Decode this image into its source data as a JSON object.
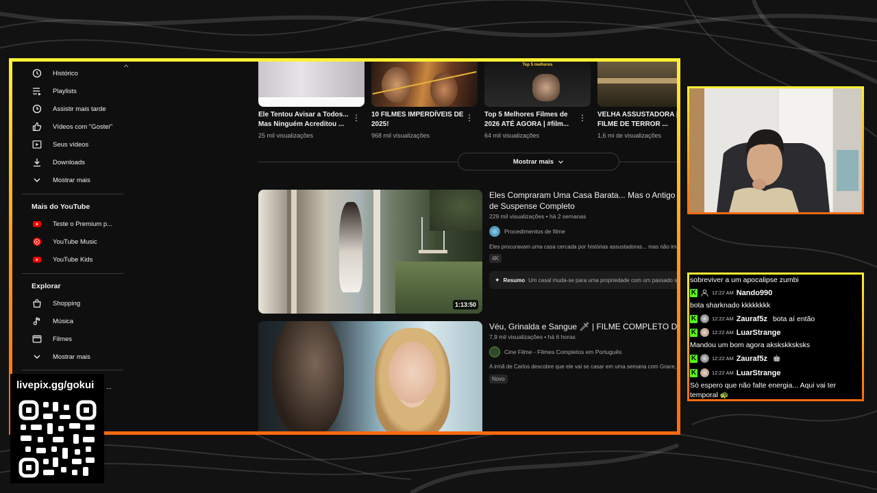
{
  "sidebar": {
    "items_top": [
      {
        "icon": "history-icon",
        "label": "Histórico"
      },
      {
        "icon": "playlists-icon",
        "label": "Playlists"
      },
      {
        "icon": "watch-later-icon",
        "label": "Assistir mais tarde"
      },
      {
        "icon": "liked-videos-icon",
        "label": "Vídeos com \"Gostei\""
      },
      {
        "icon": "your-videos-icon",
        "label": "Seus vídeos"
      },
      {
        "icon": "downloads-icon",
        "label": "Downloads"
      },
      {
        "icon": "chevron-down-icon",
        "label": "Mostrar mais"
      }
    ],
    "more_header": "Mais do YouTube",
    "more_items": [
      {
        "icon": "youtube-premium-icon",
        "label": "Teste o Premium p..."
      },
      {
        "icon": "youtube-music-icon",
        "label": "YouTube Music"
      },
      {
        "icon": "youtube-kids-icon",
        "label": "YouTube Kids"
      }
    ],
    "explore_header": "Explorar",
    "explore_items": [
      {
        "icon": "shopping-icon",
        "label": "Shopping"
      },
      {
        "icon": "music-icon",
        "label": "Música"
      },
      {
        "icon": "movies-icon",
        "label": "Filmes"
      },
      {
        "icon": "chevron-down-icon",
        "label": "Mostrar mais"
      }
    ],
    "partial_item": "..."
  },
  "top_videos": [
    {
      "title_line1": "Ele Tentou Avisar a Todos...",
      "title_line2": "Mas Ninguém Acreditou ...",
      "views": "25 mil visualizações"
    },
    {
      "title_line1": "10 FILMES IMPERDÍVEIS DE",
      "title_line2": "2025!",
      "views": "968 mil visualizações"
    },
    {
      "title_line1": "Top 5 Melhores Filmes de",
      "title_line2": "2026 ATÉ AGORA  |  #film...",
      "views": "64 mil visualizações",
      "thumb_text": "Top 5 melhores"
    },
    {
      "title_line1": "VELHA ASSUSTADORA |",
      "title_line2": "FILME DE TERROR ...",
      "views": "1,6 mi de visualizações"
    }
  ],
  "show_more_label": "Mostrar mais",
  "videos": [
    {
      "title_line1": "Eles Compraram Uma Casa Barata... Mas o Antigo M",
      "title_line2": "de Suspense Completo",
      "meta": "229 mil visualizações • há 2 semanas",
      "channel": "Procedimentos de filme",
      "description": "Eles procuravam uma casa cercada por histórias assustadoras... mas não ima",
      "badge": "4K",
      "duration": "1:13:50",
      "summary_label": "Resumo",
      "summary_text": "Um casal muda-se para uma propriedade com um passado so"
    },
    {
      "title_line1": "Véu, Grinalda e Sangue 🗡 | FILME COMPLETO DUBL",
      "meta": "7,9 mil visualizações • há 6 horas",
      "channel": "Cine Filme - Filmes Completos em Português",
      "description": "A irmã de Carlos descobre que ele vai se casar em uma semana com Grace, u",
      "badge": "Novo"
    }
  ],
  "chat": {
    "messages": [
      {
        "type": "text",
        "text": "sobreviver a um apocalipse zumbi"
      },
      {
        "type": "user",
        "time": "12:22 AM",
        "user": "Nando990",
        "inline": ""
      },
      {
        "type": "text",
        "text": "bota sharknado kkkkkkkk"
      },
      {
        "type": "user",
        "time": "12:22 AM",
        "user": "Zauraf5z",
        "inline": "bota aí então"
      },
      {
        "type": "user",
        "time": "12:22 AM",
        "user": "LuarStrange",
        "inline": ""
      },
      {
        "type": "text",
        "text": "Mandou um bom agora akskskksksks"
      },
      {
        "type": "user",
        "time": "12:22 AM",
        "user": "Zauraf5z",
        "inline": "🤖"
      },
      {
        "type": "user",
        "time": "12:22 AM",
        "user": "LuarStrange",
        "inline": ""
      },
      {
        "type": "text",
        "text": "Só espero que não falte energia... Aqui vai ter"
      },
      {
        "type": "text",
        "text": "temporal 🐢"
      }
    ]
  },
  "donation": {
    "url": "livepix.gg/gokui"
  },
  "colors": {
    "frame_top": "#fff033",
    "frame_bottom": "#ff6a12",
    "kick_green": "#53fc18",
    "yt_red": "#ff0000"
  }
}
